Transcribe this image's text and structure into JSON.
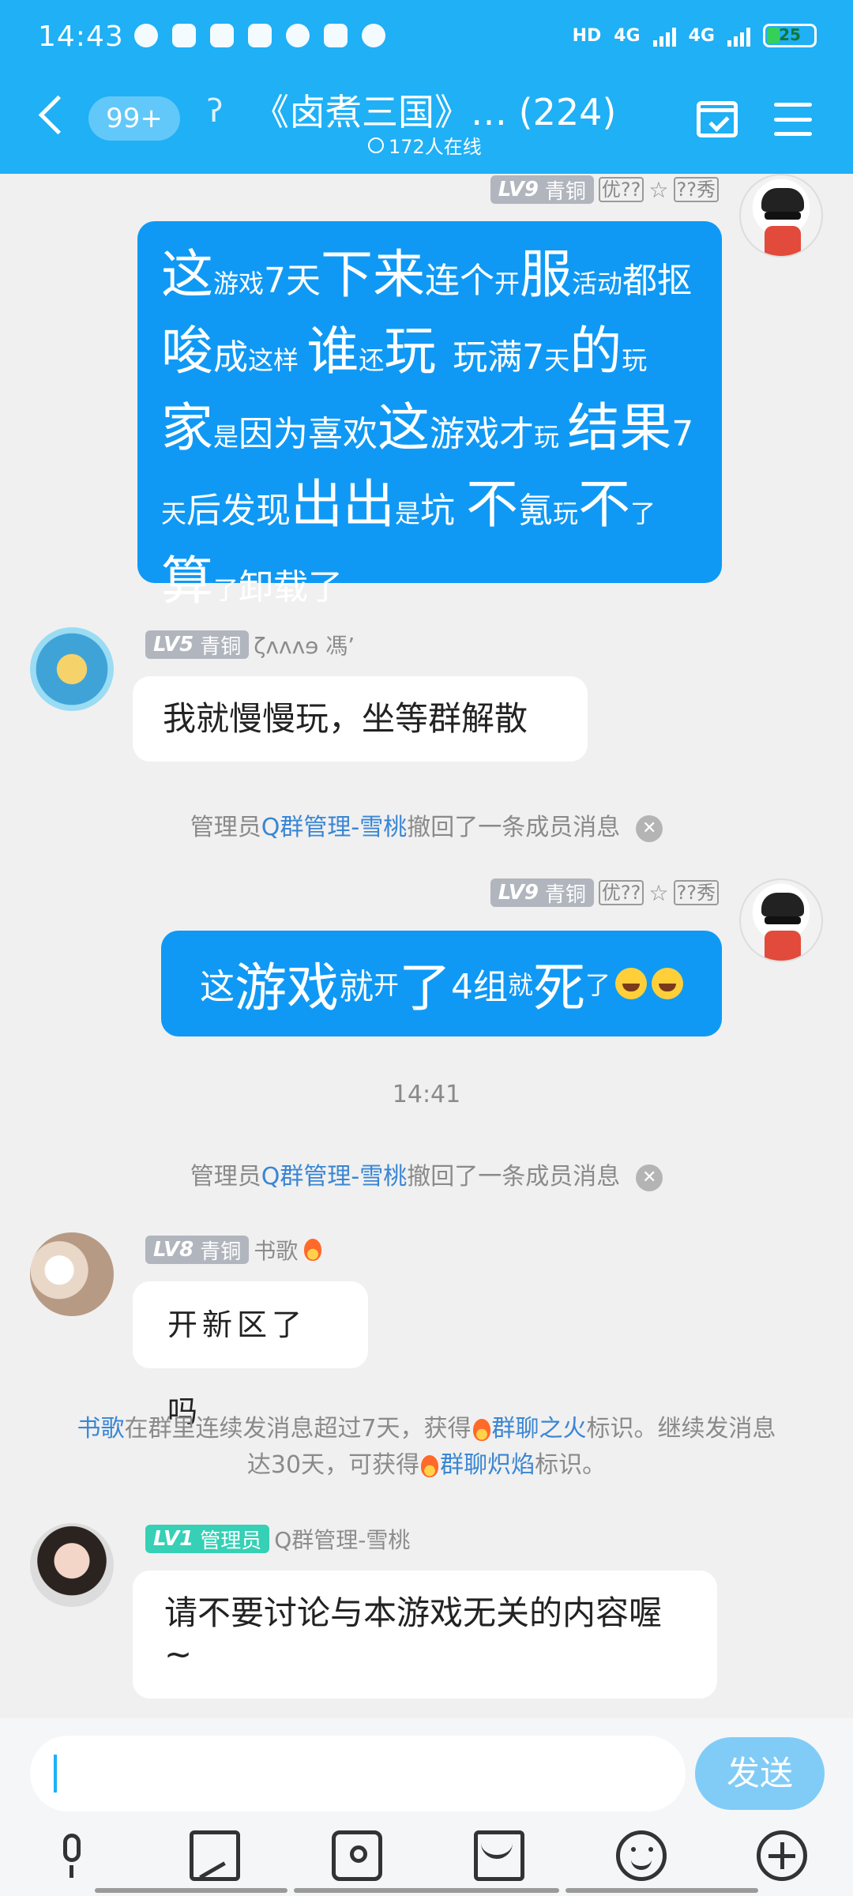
{
  "status_bar": {
    "time": "14:43",
    "network_1": "4G",
    "network_2": "4G",
    "battery": "25"
  },
  "header": {
    "unread_count": "99+",
    "title": "《卤煮三国》… (224)",
    "online_count": "172人在线"
  },
  "messages": [
    {
      "side": "right",
      "level": "LV9",
      "badge": "青铜",
      "nickname_tags": [
        "优??",
        "☆",
        "??秀"
      ],
      "text": "这游戏7天下来连个开服活动都抠唆成这样 谁还玩 玩满7天的玩家是因为喜欢这游戏才玩 结果7天后发现出出是坑 不氪玩不了 算了卸载了"
    },
    {
      "side": "left",
      "level": "LV5",
      "badge": "青铜",
      "nickname": "ζᴧᴧᴧɘ 馮’",
      "text": "我就慢慢玩，坐等群解散"
    },
    {
      "side": "right",
      "level": "LV9",
      "badge": "青铜",
      "nickname_tags": [
        "优??",
        "☆",
        "??秀"
      ],
      "text": "这游戏就开了4组就死了"
    },
    {
      "side": "left",
      "level": "LV8",
      "badge": "青铜",
      "nickname": "书歌",
      "text": "开新区了吗"
    },
    {
      "side": "left",
      "level": "LV1",
      "badge": "管理员",
      "nickname": "Q群管理-雪桃",
      "text": "请不要讨论与本游戏无关的内容喔~"
    }
  ],
  "system": {
    "recall_prefix": "管理员",
    "recall_admin": "Q群管理-雪桃",
    "recall_suffix": "撤回了一条成员消息",
    "timestamp": "14:41",
    "fire_user": "书歌",
    "fire_line1_mid": "在群里连续发消息超过7天，获得",
    "fire_badge1": "群聊之火",
    "fire_line1_end": "标识。继续发消息",
    "fire_line2_start": "达30天，可获得",
    "fire_badge2": "群聊炽焰",
    "fire_line2_end": "标识。"
  },
  "input": {
    "send_label": "发送"
  },
  "colors": {
    "header": "#1fb0f6",
    "self_bubble": "#0f99f5",
    "link": "#3a86d4",
    "send_button": "#80ccf7"
  }
}
